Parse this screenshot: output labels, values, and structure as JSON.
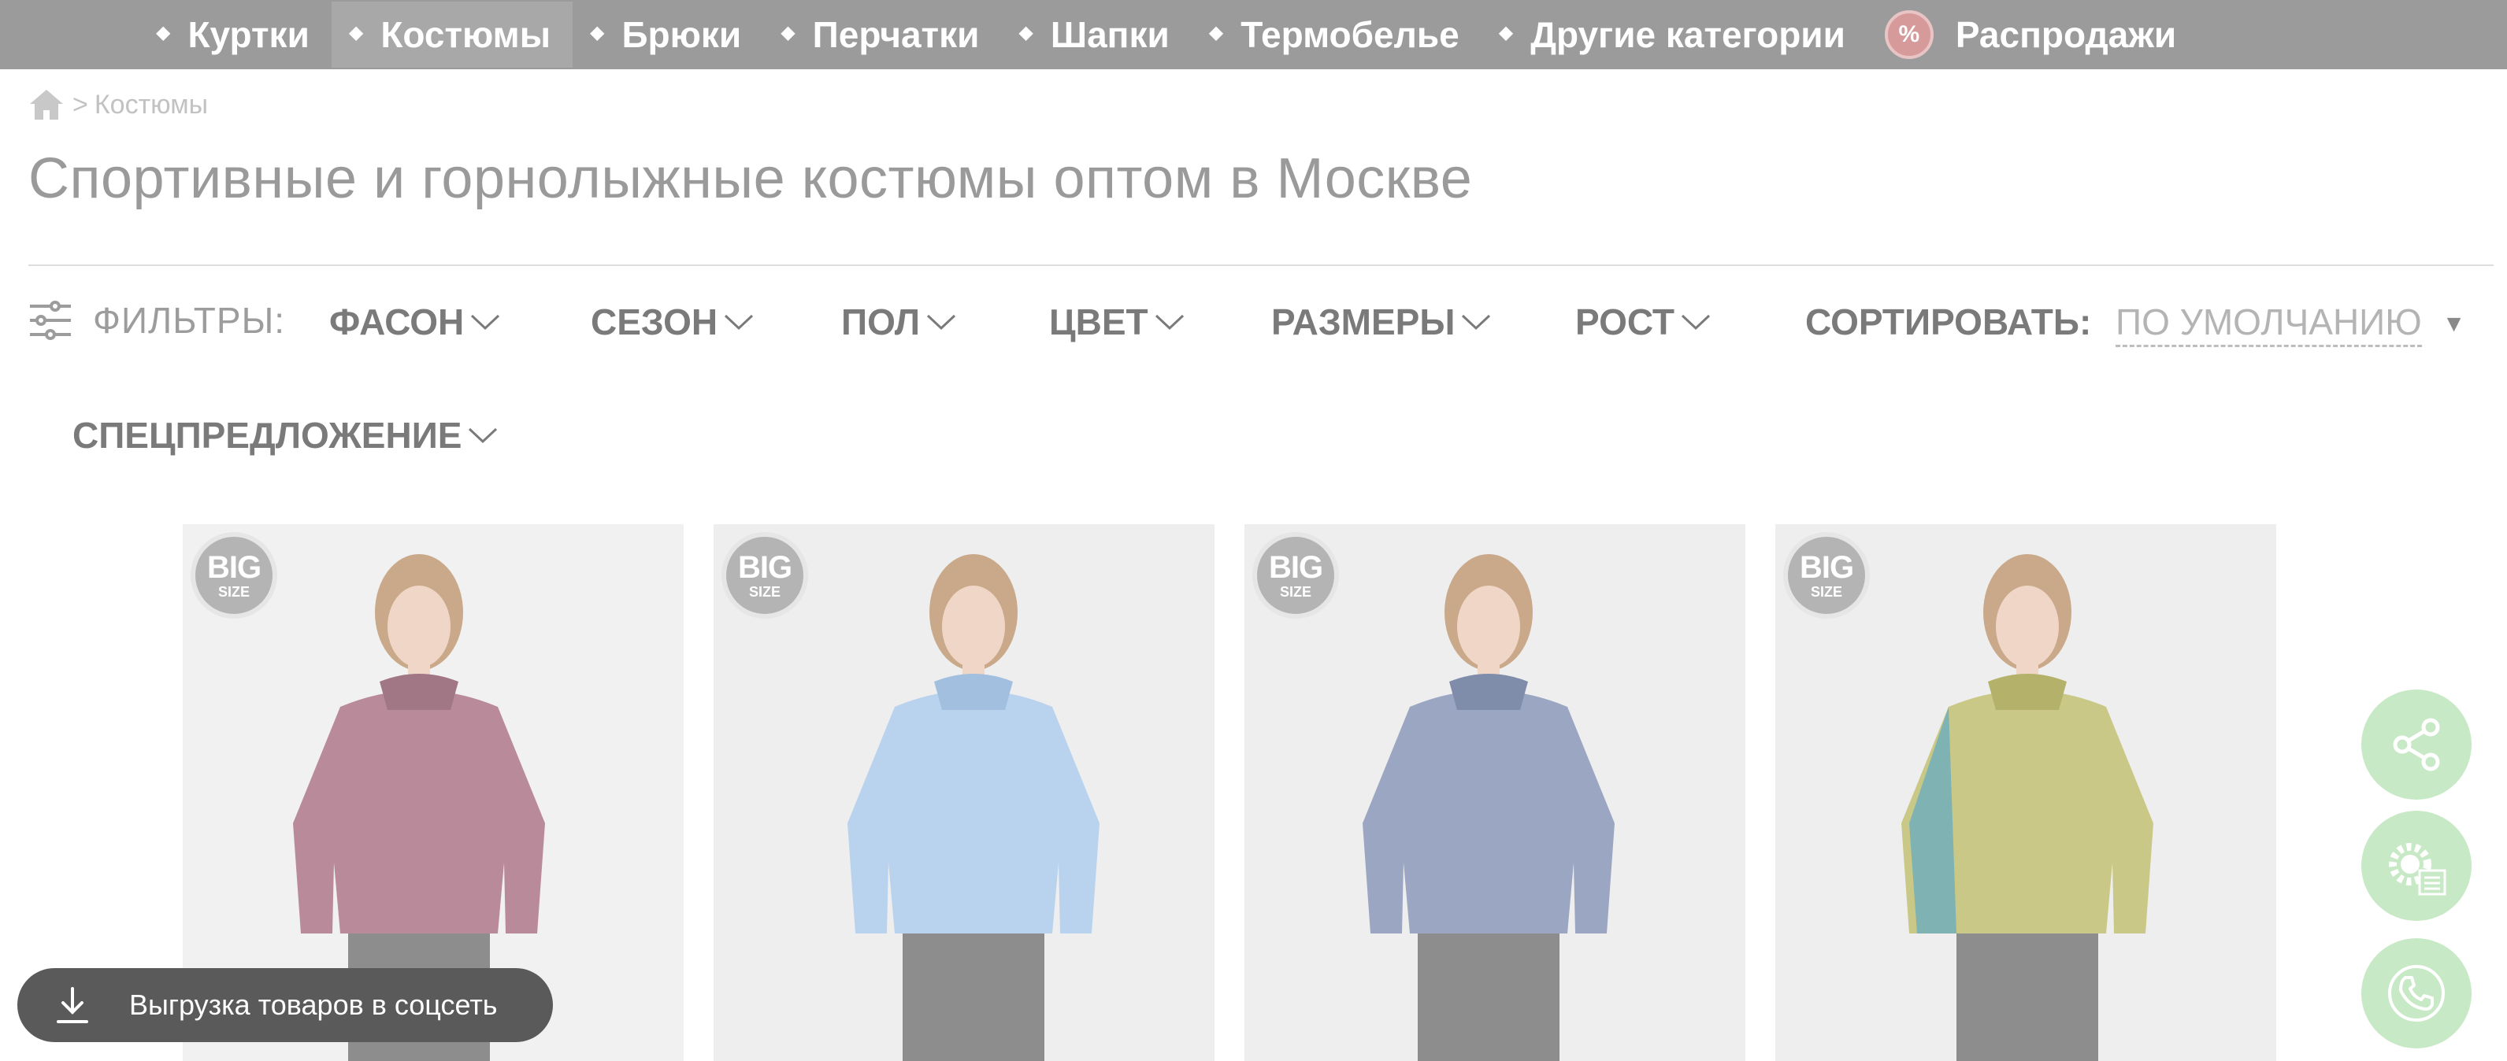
{
  "nav": {
    "items": [
      {
        "label": "Куртки"
      },
      {
        "label": "Костюмы"
      },
      {
        "label": "Брюки"
      },
      {
        "label": "Перчатки"
      },
      {
        "label": "Шапки"
      },
      {
        "label": "Термобелье"
      },
      {
        "label": "Другие категории"
      }
    ],
    "sale": {
      "badge": "%",
      "label": "Распродажи"
    }
  },
  "breadcrumb": {
    "separator": ">",
    "current": "Костюмы"
  },
  "page_title": "Спортивные и горнолыжные костюмы оптом в Москве",
  "filters": {
    "label": "ФИЛЬТРЫ:",
    "items": [
      {
        "label": "ФАСОН"
      },
      {
        "label": "СЕЗОН"
      },
      {
        "label": "ПОЛ"
      },
      {
        "label": "ЦВЕТ"
      },
      {
        "label": "РАЗМЕРЫ"
      },
      {
        "label": "РОСТ"
      }
    ],
    "special": "СПЕЦПРЕДЛОЖЕНИЕ",
    "sort_label": "СОРТИРОВАТЬ:",
    "sort_value": "ПО УМОЛЧАНИЮ"
  },
  "products": [
    {
      "badge_big": "BIG",
      "badge_size": "SIZE",
      "jacket_color": "#b98a99"
    },
    {
      "badge_big": "BIG",
      "badge_size": "SIZE",
      "jacket_color": "#b9d2ee"
    },
    {
      "badge_big": "BIG",
      "badge_size": "SIZE",
      "jacket_color": "#9aa6c2"
    },
    {
      "badge_big": "BIG",
      "badge_size": "SIZE",
      "jacket_color": "#c9c886"
    }
  ],
  "floating": [
    "share-icon",
    "settings-list-icon",
    "phone-icon"
  ],
  "export_button": "Выгрузка товаров в соцсеть",
  "colors": {
    "nav_bg": "#9b9b9b",
    "fab_green": "#c8e9c6",
    "export_bg": "#5a5a5a"
  }
}
